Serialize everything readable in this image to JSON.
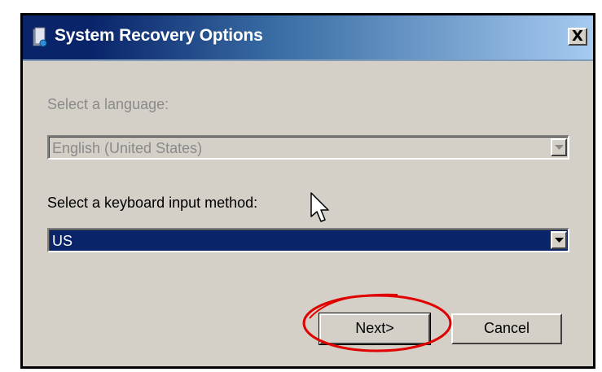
{
  "window": {
    "title": "System Recovery Options",
    "close_label": "X",
    "icon": "recovery-app-icon"
  },
  "language": {
    "label": "Select a language:",
    "value": "English (United States)",
    "disabled": true
  },
  "keyboard": {
    "label": "Select a keyboard input method:",
    "value": "US"
  },
  "buttons": {
    "next_label": "Next>",
    "cancel_label": "Cancel"
  },
  "annotation": {
    "highlight": "next-button",
    "highlight_color": "#e00000"
  },
  "colors": {
    "title_bar_start": "#0a246a",
    "title_bar_end": "#a6caf0",
    "dialog_bg": "#d4d0c8",
    "selection_bg": "#0a246a"
  }
}
